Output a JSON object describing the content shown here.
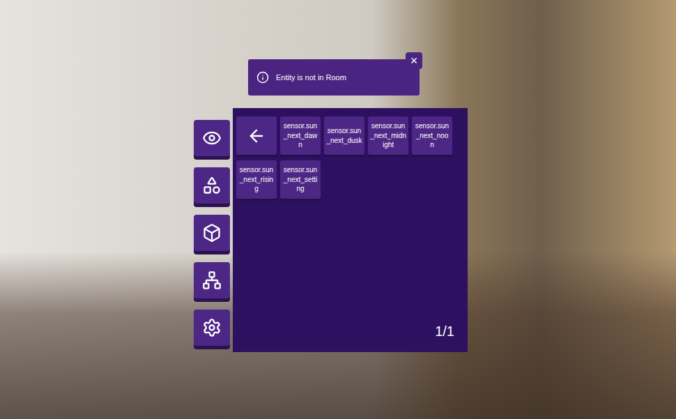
{
  "toast": {
    "message": "Entity is not in Room",
    "close": "×"
  },
  "sidebar": {
    "items": [
      {
        "name": "view"
      },
      {
        "name": "widgets"
      },
      {
        "name": "3d-objects"
      },
      {
        "name": "hierarchy"
      },
      {
        "name": "settings"
      }
    ]
  },
  "entities": [
    {
      "label": "sensor.sun_next_dawn"
    },
    {
      "label": "sensor.sun_next_dusk"
    },
    {
      "label": "sensor.sun_next_midnight"
    },
    {
      "label": "sensor.sun_next_noon"
    },
    {
      "label": "sensor.sun_next_rising"
    },
    {
      "label": "sensor.sun_next_setting"
    }
  ],
  "pager": "1/1"
}
